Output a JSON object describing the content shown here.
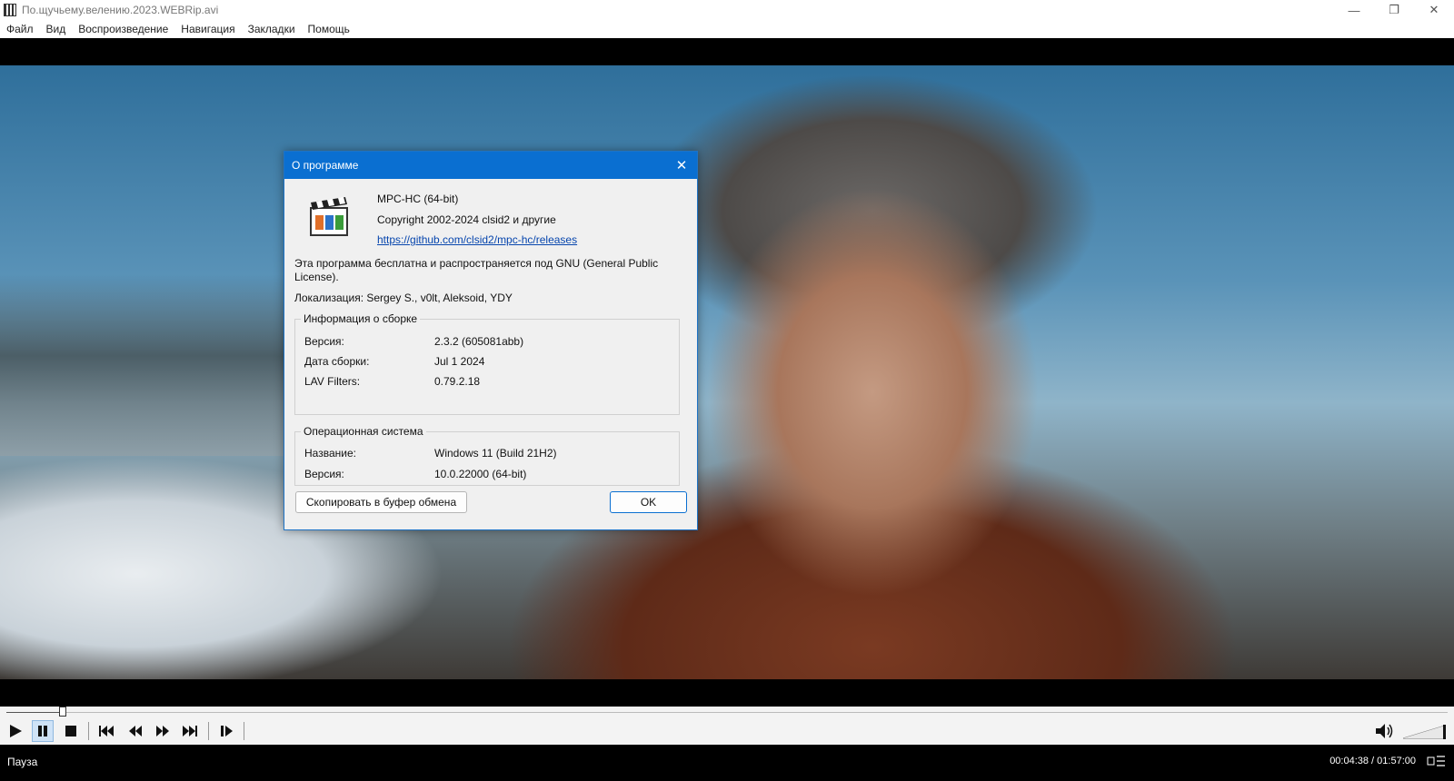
{
  "window": {
    "title": "По.щучьему.велению.2023.WEBRip.avi",
    "minimize": "—",
    "maximize": "❐",
    "close": "✕"
  },
  "menu": [
    "Файл",
    "Вид",
    "Воспроизведение",
    "Навигация",
    "Закладки",
    "Помощь"
  ],
  "dialog": {
    "title": "О программе",
    "close": "✕",
    "product": "MPC-HC (64-bit)",
    "copyright": "Copyright 2002-2024 clsid2 и другие",
    "link": "https://github.com/clsid2/mpc-hc/releases",
    "license_line1": "Эта программа бесплатна и распространяется под GNU (General Public",
    "license_line2": "License).",
    "localization": "Локализация: Sergey S., v0lt, Aleksoid, YDY",
    "build_group": {
      "label": "Информация о сборке",
      "rows": [
        {
          "key": "Версия:",
          "value": "2.3.2 (605081abb)"
        },
        {
          "key": "Дата сборки:",
          "value": "Jul  1 2024"
        },
        {
          "key": "LAV Filters:",
          "value": "0.79.2.18"
        }
      ]
    },
    "os_group": {
      "label": "Операционная система",
      "rows": [
        {
          "key": "Название:",
          "value": "Windows 11 (Build 21H2)"
        },
        {
          "key": "Версия:",
          "value": "10.0.22000 (64-bit)"
        }
      ]
    },
    "copy_button": "Скопировать в буфер обмена",
    "ok_button": "OK"
  },
  "playback": {
    "progress": 0.039,
    "volume": 1.0
  },
  "status": {
    "state": "Пауза",
    "time": "00:04:38 / 01:57:00"
  },
  "colors": {
    "accent": "#0a6fd1",
    "link": "#0645ad",
    "status_bg": "#000000"
  }
}
